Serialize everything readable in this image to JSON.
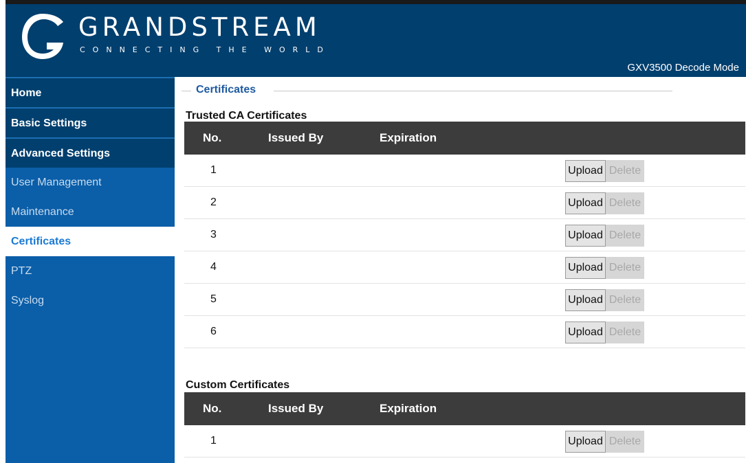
{
  "header": {
    "brand": "GRANDSTREAM",
    "tagline": "CONNECTING THE WORLD",
    "mode": "GXV3500 Decode Mode",
    "logo_icon": "grandstream-logo-icon",
    "bg_color": "#003f6e"
  },
  "sidebar": {
    "items": [
      {
        "label": "Home"
      },
      {
        "label": "Basic Settings"
      },
      {
        "label": "Advanced Settings"
      },
      {
        "label": "User Management"
      },
      {
        "label": "Maintenance"
      },
      {
        "label": "Certificates"
      },
      {
        "label": "PTZ"
      },
      {
        "label": "Syslog"
      }
    ],
    "active": "Certificates"
  },
  "main": {
    "section_title": "Certificates",
    "trusted": {
      "title": "Trusted CA Certificates",
      "columns": [
        "No.",
        "Issued By",
        "Expiration"
      ],
      "rows": [
        {
          "no": "1",
          "upload": "Upload",
          "delete": "Delete"
        },
        {
          "no": "2",
          "upload": "Upload",
          "delete": "Delete"
        },
        {
          "no": "3",
          "upload": "Upload",
          "delete": "Delete"
        },
        {
          "no": "4",
          "upload": "Upload",
          "delete": "Delete"
        },
        {
          "no": "5",
          "upload": "Upload",
          "delete": "Delete"
        },
        {
          "no": "6",
          "upload": "Upload",
          "delete": "Delete"
        }
      ]
    },
    "custom": {
      "title": "Custom Certificates",
      "columns": [
        "No.",
        "Issued By",
        "Expiration"
      ],
      "rows": [
        {
          "no": "1",
          "upload": "Upload",
          "delete": "Delete"
        }
      ]
    }
  }
}
